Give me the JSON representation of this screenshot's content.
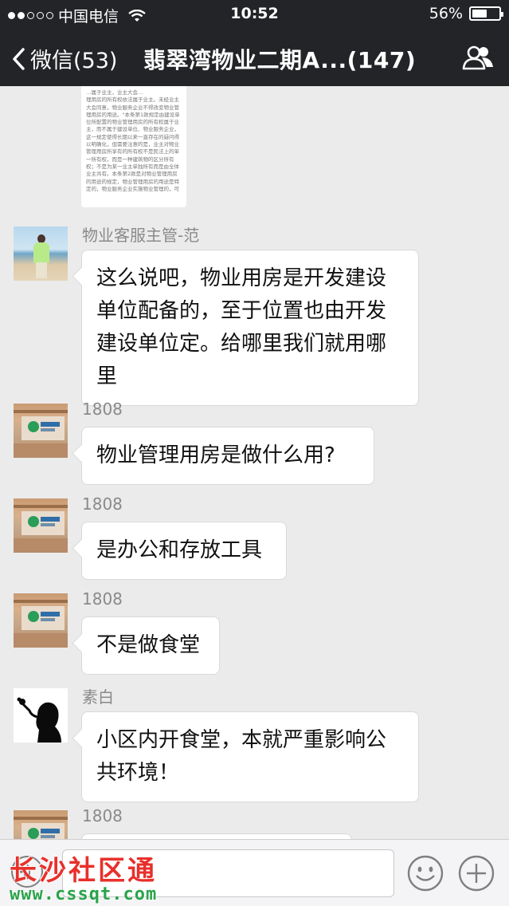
{
  "status_bar": {
    "carrier": "中国电信",
    "time": "10:52",
    "battery_percent": "56%",
    "battery_level": 0.56
  },
  "nav": {
    "back_label": "微信(53)",
    "title": "翡翠湾物业二期A...(147)"
  },
  "image_message": {
    "lines": [
      "…属于业主，业主大会…",
      "理用房的所有权依法属于业主。未经业主",
      "大会同意，物业服务企业不得改变物业管",
      "理用房的用途。\"本条第1款规定由建设单",
      "位所配置的物业管理用房的所有权属于业",
      "主，而不属于建设单位、物业服务企业，",
      "这一规定使得长期以来一直存在的疑问得",
      "以明确化，但需要注意的是，业主对物业",
      "管理用房所享有的所有权不是民法上的单",
      "一所有权，而是一种建筑物的区分所有",
      "权；不是为某一业主单独所有而是由全体",
      "业主共有。本条第2款是对物业管理用房",
      "的用途的规定，物业管理用房的用途是特",
      "定的，物业服务企业实施物业管理的，可"
    ]
  },
  "messages": [
    {
      "sender": "物业客服主管-范",
      "avatar": "photo-avatar",
      "text": "这么说吧，物业用房是开发建设单位配备的，至于位置也由开发建设单位定。给哪里我们就用哪里"
    },
    {
      "sender": "1808",
      "avatar": "office-avatar",
      "text": "物业管理用房是做什么用?"
    },
    {
      "sender": "1808",
      "avatar": "office-avatar",
      "text": "是办公和存放工具"
    },
    {
      "sender": "1808",
      "avatar": "office-avatar",
      "text": "不是做食堂"
    },
    {
      "sender": "素白",
      "avatar": "silhouette-avatar",
      "text": "小区内开食堂，本就严重影响公共环境！"
    },
    {
      "sender": "1808",
      "avatar": "office-avatar",
      "text": ""
    }
  ],
  "watermark": {
    "title": "长沙社区通",
    "url": "www.cssqt.com"
  },
  "icons": {
    "back": "chevron-left-icon",
    "group_info": "people-icon",
    "voice": "voice-icon",
    "emoji": "emoji-icon",
    "more": "plus-icon"
  }
}
